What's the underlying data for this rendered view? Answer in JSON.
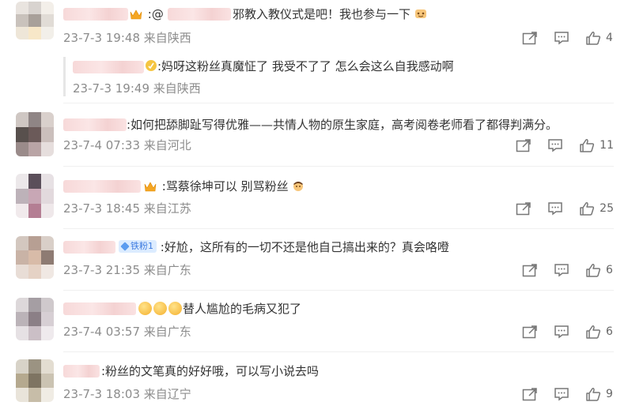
{
  "comments": [
    {
      "text": ":@",
      "mention_blur": true,
      "text_after": "邪教入教仪式是吧！我也参与一下",
      "time": "23-7-3 19:48 来自陕西",
      "like_count": "4"
    },
    {
      "reply": true,
      "text": ":妈呀这粉丝真魔怔了 我受不了了 怎么会这么自我感动啊",
      "time": "23-7-3 19:49 来自陕西"
    },
    {
      "text": ":如何把舔脚趾写得优雅——共情人物的原生家庭，高考阅卷老师看了都得判满分。",
      "time": "23-7-4 07:33 来自河北",
      "like_count": "11"
    },
    {
      "text": ":骂蔡徐坤可以 别骂粉丝",
      "time": "23-7-3 18:45 来自江苏",
      "like_count": "25"
    },
    {
      "badge": "铁粉1",
      "text": ":好尬，这所有的一切不还是他自己搞出来的？真会咯噔",
      "time": "23-7-3 21:35 来自广东",
      "like_count": "6"
    },
    {
      "text": "替人尴尬的毛病又犯了",
      "time": "23-7-4 03:57 来自广东",
      "like_count": "6"
    },
    {
      "text": ":粉丝的文笔真的好好哦，可以写小说去吗",
      "time": "23-7-3 18:03 来自辽宁",
      "like_count": "9"
    }
  ],
  "icons": {
    "forward": "share-icon",
    "comment": "comment-icon",
    "like": "thumbs-up-icon"
  },
  "colors": {
    "meta": "#8c8c8c",
    "text": "#333333",
    "badge_bg": "#dcecff",
    "badge_text": "#3d7be0"
  }
}
